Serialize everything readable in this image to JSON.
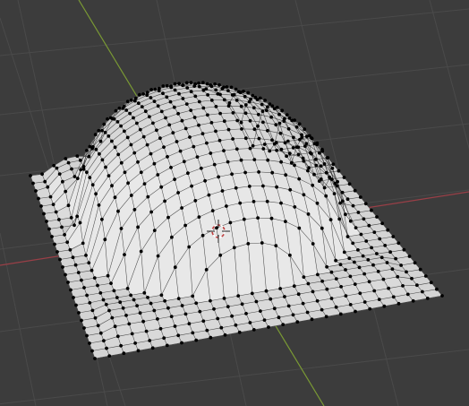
{
  "viewport": {
    "mode": "edit",
    "object_type": "mesh-grid",
    "selection": "all-vertices",
    "colors": {
      "background": "#3c3c3c",
      "grid_line": "#4a4a4a",
      "grid_line_minor": "#444444",
      "axis_x": "#9a3f47",
      "axis_y": "#7a9a34",
      "mesh_light": "#d8d8d8",
      "mesh_mid": "#bdbdbd",
      "mesh_dark": "#9c9c9c",
      "mesh_edge": "#1a1a1a",
      "vertex": "#000000",
      "cursor_ring_red": "#c04040",
      "cursor_ring_white": "#ffffff"
    },
    "icons": [
      "3d-cursor-icon"
    ]
  }
}
